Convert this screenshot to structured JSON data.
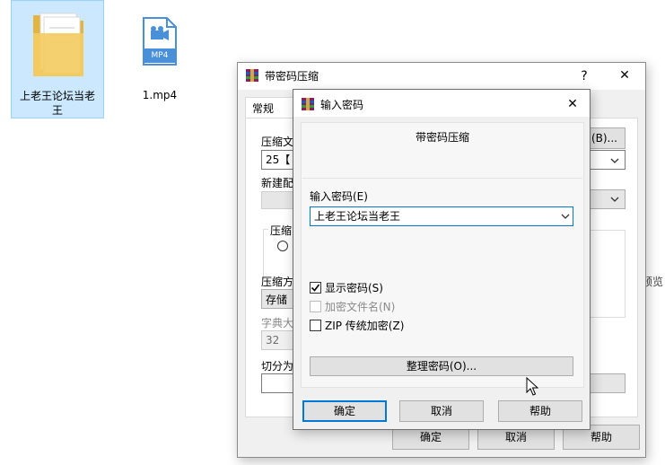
{
  "desktop": {
    "folder_label": "上老王论坛当老王",
    "video_badge": "MP4",
    "video_label": "1.mp4",
    "preview_partial": "预览"
  },
  "back_dialog": {
    "title": "带密码压缩",
    "help_glyph": "?",
    "close_glyph": "✕",
    "tab_general": "常规",
    "archive_name_label": "压缩文",
    "archive_name_value": "25【",
    "browse_button": "(B)...",
    "profile_label": "新建配",
    "format_group": "压缩",
    "method_label": "压缩方",
    "method_value": "存储",
    "dict_label": "字典大",
    "dict_value": "32",
    "split_label": "切分为",
    "ok": "确定",
    "cancel": "取消",
    "help": "帮助"
  },
  "password_dialog": {
    "title": "输入密码",
    "close_glyph": "✕",
    "heading": "带密码压缩",
    "password_label": "输入密码(E)",
    "password_value": "上老王论坛当老王",
    "show_password": {
      "label": "显示密码(S)",
      "checked": true
    },
    "encrypt_names": {
      "label": "加密文件名(N)",
      "checked": false,
      "enabled": false
    },
    "zip_legacy": {
      "label": "ZIP 传统加密(Z)",
      "checked": false
    },
    "organize_button": "整理密码(O)...",
    "ok": "确定",
    "cancel": "取消",
    "help": "帮助"
  },
  "colors": {
    "folder": "#f3cc63",
    "selection": "#cce8ff",
    "video_icon": "#4a90d9",
    "default_button_border": "#0078d7"
  }
}
